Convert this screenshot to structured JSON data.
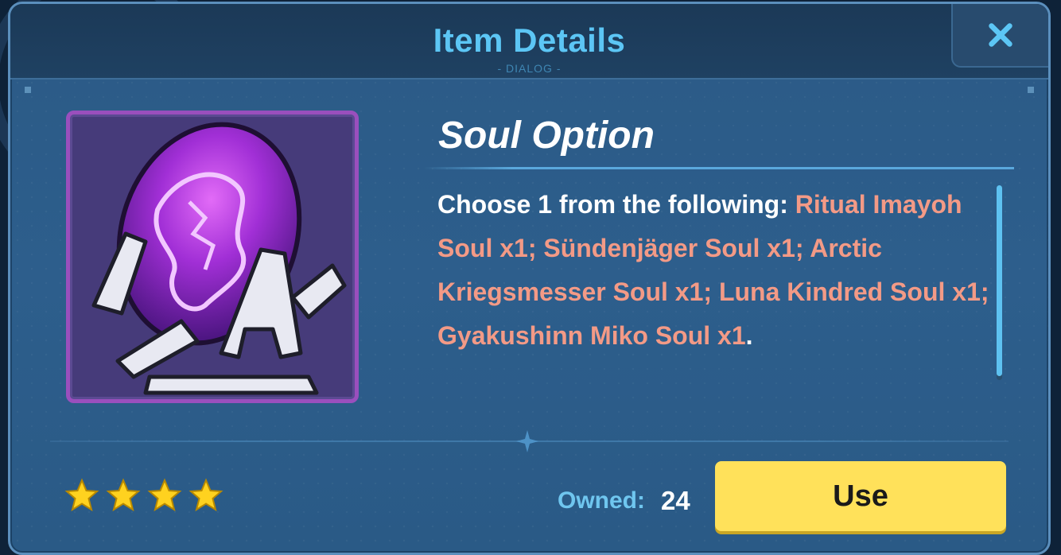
{
  "dialog": {
    "title": "Item Details",
    "subtitle": "- DIALOG -",
    "close_icon": "close-icon"
  },
  "item": {
    "name": "Soul Option",
    "icon": "purple-soul-egg-icon",
    "description_prefix": "Choose 1 from the following: ",
    "description_items": "Ritual Imayoh Soul x1; Sündenjäger Soul x1; Arctic Kriegsmesser Soul x1; Luna Kindred Soul x1; Gyakushinn Miko Soul x1",
    "description_suffix": ".",
    "rarity_stars": 4
  },
  "footer": {
    "owned_label": "Owned:",
    "owned_value": "24",
    "use_label": "Use"
  },
  "colors": {
    "accent_title": "#5cc6f5",
    "highlight_text": "#f39a86",
    "use_button": "#ffe15a",
    "star": "#ffd21f"
  }
}
